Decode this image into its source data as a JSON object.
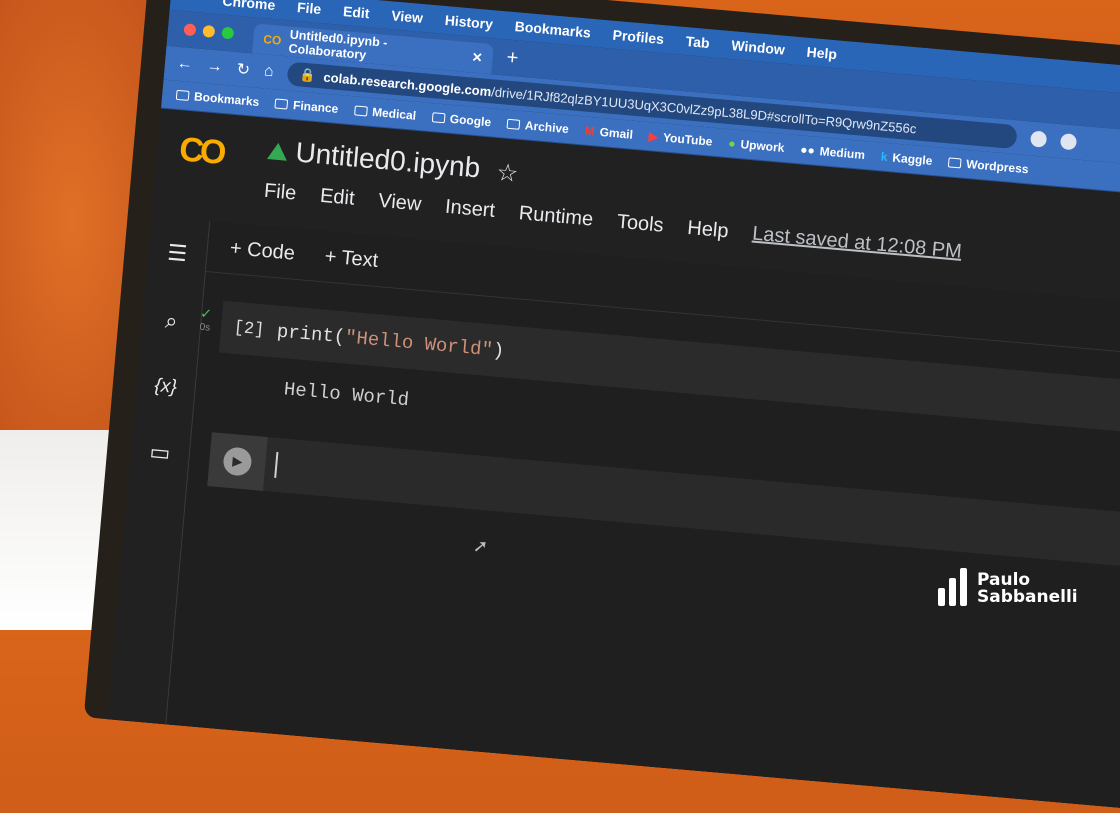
{
  "mac_menu": [
    "Chrome",
    "File",
    "Edit",
    "View",
    "History",
    "Bookmarks",
    "Profiles",
    "Tab",
    "Window",
    "Help"
  ],
  "tab": {
    "logo": "CO",
    "title": "Untitled0.ipynb - Colaboratory"
  },
  "address": {
    "domain": "colab.research.google.com",
    "path": "/drive/1RJf82qlzBY1UU3UqX3C0vlZz9pL38L9D#scrollTo=R9Qrw9nZ556c"
  },
  "bookmarks": [
    "Bookmarks",
    "Finance",
    "Medical",
    "Google",
    "Archive",
    "Gmail",
    "YouTube",
    "Upwork",
    "Medium",
    "Kaggle",
    "Wordpress"
  ],
  "colab": {
    "logo": "CO",
    "title": "Untitled0.ipynb",
    "menus": [
      "File",
      "Edit",
      "View",
      "Insert",
      "Runtime",
      "Tools",
      "Help"
    ],
    "last_saved": "Last saved at 12:08 PM",
    "add_code": "+ Code",
    "add_text": "+ Text",
    "sidebar_icons": [
      "list-icon",
      "search-icon",
      "variables-icon",
      "folder-icon"
    ]
  },
  "cell": {
    "status_time": "0s",
    "exec_count": "[2]",
    "code_fn": "print(",
    "code_str": "\"Hello World\"",
    "code_end": ")",
    "output": "Hello World"
  },
  "watermark": {
    "line1": "Paulo",
    "line2": "Sabbanelli"
  }
}
